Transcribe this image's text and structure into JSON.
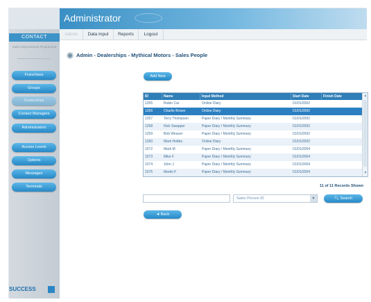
{
  "window": {
    "title": "Administrator"
  },
  "brand": {
    "name": "CONTACT",
    "subtitle": "Sales Improvement Programme",
    "footer_logo": "SUCCESS"
  },
  "sidebar": {
    "items": [
      {
        "label": "Franchises",
        "enabled": true
      },
      {
        "label": "Groups",
        "enabled": true
      },
      {
        "label": "Dealerships",
        "enabled": false
      },
      {
        "label": "Contact Managers",
        "enabled": true
      },
      {
        "label": "Administrators",
        "enabled": true
      },
      {
        "label": "Access Levels",
        "enabled": true
      },
      {
        "label": "Options",
        "enabled": true
      },
      {
        "label": "Messages",
        "enabled": true
      },
      {
        "label": "Terminals",
        "enabled": true
      }
    ]
  },
  "nav": {
    "items": [
      {
        "label": "Admin",
        "active": false
      },
      {
        "label": "Data Input",
        "active": true
      },
      {
        "label": "Reports",
        "active": true
      },
      {
        "label": "Logout",
        "active": true
      }
    ]
  },
  "page": {
    "title": "Admin - Dealerships - Mythical Motors - Sales People",
    "add_new_label": "Add New",
    "back_label": "◄ Back"
  },
  "table": {
    "columns": [
      "ID",
      "Name",
      "Input Method",
      "Start Date",
      "Finish Date"
    ],
    "rows": [
      {
        "id": "1255",
        "name": "Robin Car",
        "method": "Online Diary",
        "start": "01/01/2002",
        "finish": ""
      },
      {
        "id": "1256",
        "name": "Charlie Brown",
        "method": "Online Diary",
        "start": "01/01/2002",
        "finish": "",
        "selected": true
      },
      {
        "id": "1257",
        "name": "Terry Thompson",
        "method": "Paper Diary / Monthly Summary",
        "start": "01/01/2002",
        "finish": ""
      },
      {
        "id": "1258",
        "name": "Nick Swapper",
        "method": "Paper Diary / Monthly Summary",
        "start": "01/01/2002",
        "finish": ""
      },
      {
        "id": "1259",
        "name": "Bob Weaver",
        "method": "Paper Diary / Monthly Summary",
        "start": "01/01/2002",
        "finish": ""
      },
      {
        "id": "1260",
        "name": "Mark Hobbs",
        "method": "Online Diary",
        "start": "01/01/2002",
        "finish": ""
      },
      {
        "id": "1572",
        "name": "Mark M",
        "method": "Paper Diary / Monthly Summary",
        "start": "01/01/2004",
        "finish": ""
      },
      {
        "id": "1573",
        "name": "Mike F",
        "method": "Paper Diary / Monthly Summary",
        "start": "01/01/2004",
        "finish": ""
      },
      {
        "id": "1574",
        "name": "John J",
        "method": "Paper Diary / Monthly Summary",
        "start": "01/01/2004",
        "finish": ""
      },
      {
        "id": "1575",
        "name": "Martin F",
        "method": "Paper Diary / Monthly Summary",
        "start": "01/01/2004",
        "finish": ""
      }
    ],
    "records_text": "11 of 11 Records Shown"
  },
  "search": {
    "input_value": "",
    "field_selected": "Sales Person ID",
    "button_label": "Search"
  }
}
